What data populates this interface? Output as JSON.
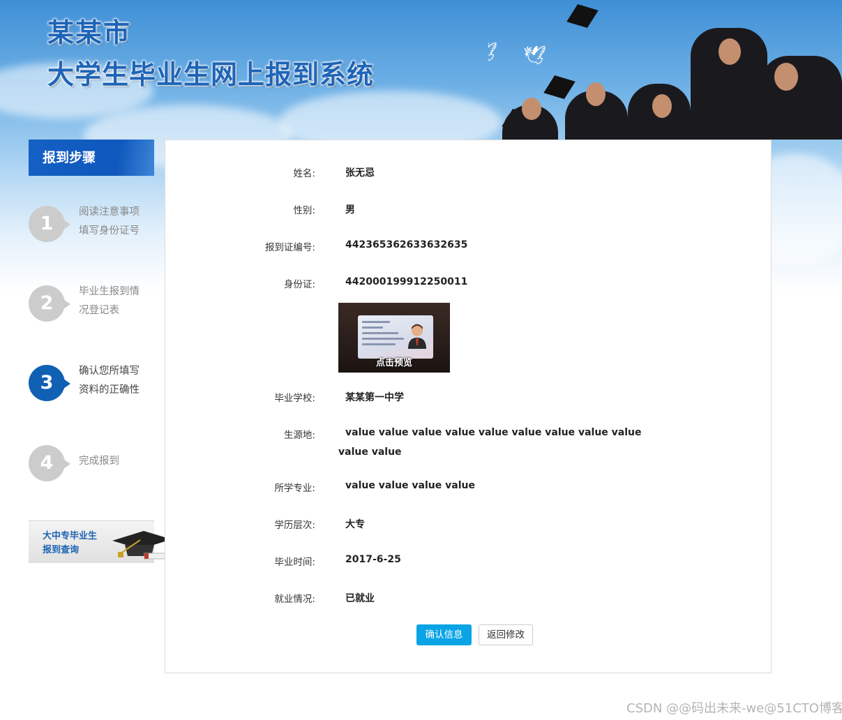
{
  "header": {
    "title_line1": "某某市",
    "title_line2": "大学生毕业生网上报到系统"
  },
  "sidebar": {
    "title": "报到步骤",
    "steps": [
      {
        "number": "1",
        "line1": "阅读注意事项",
        "line2": "填写身份证号",
        "active": false
      },
      {
        "number": "2",
        "line1": "毕业生报到情",
        "line2": "况登记表",
        "active": false
      },
      {
        "number": "3",
        "line1": "确认您所填写",
        "line2": "资料的正确性",
        "active": true
      },
      {
        "number": "4",
        "line1": "完成报到",
        "line2": "",
        "active": false
      }
    ],
    "query": {
      "line1": "大中专毕业生",
      "line2": "报到查询"
    }
  },
  "form": {
    "rows": [
      {
        "label": "姓名:",
        "value": "张无忌"
      },
      {
        "label": "性别:",
        "value": "男"
      },
      {
        "label": "报到证编号:",
        "value": "442365362633632635"
      },
      {
        "label": "身份证:",
        "value": "442000199912250011"
      },
      {
        "label": "毕业学校:",
        "value": "某某第一中学"
      },
      {
        "label": "生源地:",
        "value": "value value value value value value value value value value value"
      },
      {
        "label": "所学专业:",
        "value": "value value value value"
      },
      {
        "label": "学历层次:",
        "value": "大专"
      },
      {
        "label": "毕业时间:",
        "value": "2017-6-25"
      },
      {
        "label": "就业情况:",
        "value": "已就业"
      }
    ],
    "id_preview_caption": "点击预览",
    "confirm_button": "确认信息",
    "back_button": "返回修改"
  },
  "watermark": "CSDN @@码出未来-we@51CTO博客",
  "colors": {
    "brand_blue": "#1560c4",
    "step_active": "#1060b4",
    "step_inactive": "#cccccc",
    "primary_button": "#0aa4e6"
  }
}
